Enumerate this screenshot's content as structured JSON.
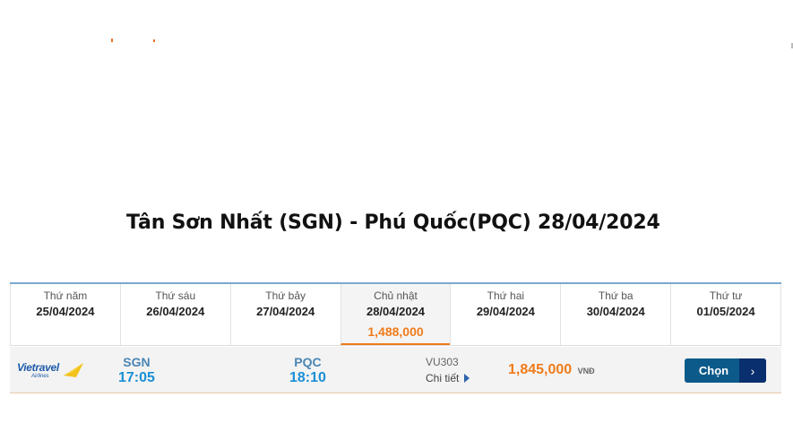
{
  "route": {
    "title": "Tân Sơn Nhất (SGN) - Phú Quốc(PQC) 28/04/2024"
  },
  "date_tabs": [
    {
      "weekday": "Thứ năm",
      "date": "25/04/2024",
      "price": ""
    },
    {
      "weekday": "Thứ sáu",
      "date": "26/04/2024",
      "price": ""
    },
    {
      "weekday": "Thứ bảy",
      "date": "27/04/2024",
      "price": ""
    },
    {
      "weekday": "Chủ nhật",
      "date": "28/04/2024",
      "price": "1,488,000"
    },
    {
      "weekday": "Thứ hai",
      "date": "29/04/2024",
      "price": ""
    },
    {
      "weekday": "Thứ ba",
      "date": "30/04/2024",
      "price": ""
    },
    {
      "weekday": "Thứ tư",
      "date": "01/05/2024",
      "price": ""
    }
  ],
  "selected_tab_index": 3,
  "flight": {
    "airline_logo_text": "Vietravel",
    "airline_logo_subtext": "Airlines",
    "departure": {
      "code": "SGN",
      "time": "17:05"
    },
    "arrival": {
      "code": "PQC",
      "time": "18:10"
    },
    "flight_number": "VU303",
    "details_label": "Chi tiết",
    "price": "1,845,000",
    "currency": "VNĐ",
    "select_label": "Chọn"
  },
  "colors": {
    "accent_orange": "#f07b1a",
    "primary_blue": "#0c5a8a",
    "dark_blue": "#0a2f6e",
    "code_blue": "#4a86b4",
    "time_blue": "#1a8fd6"
  },
  "icons": {
    "details": "play-triangle-icon",
    "select_arrow": "chevron-right-icon",
    "airline": "vietravel-logo"
  }
}
